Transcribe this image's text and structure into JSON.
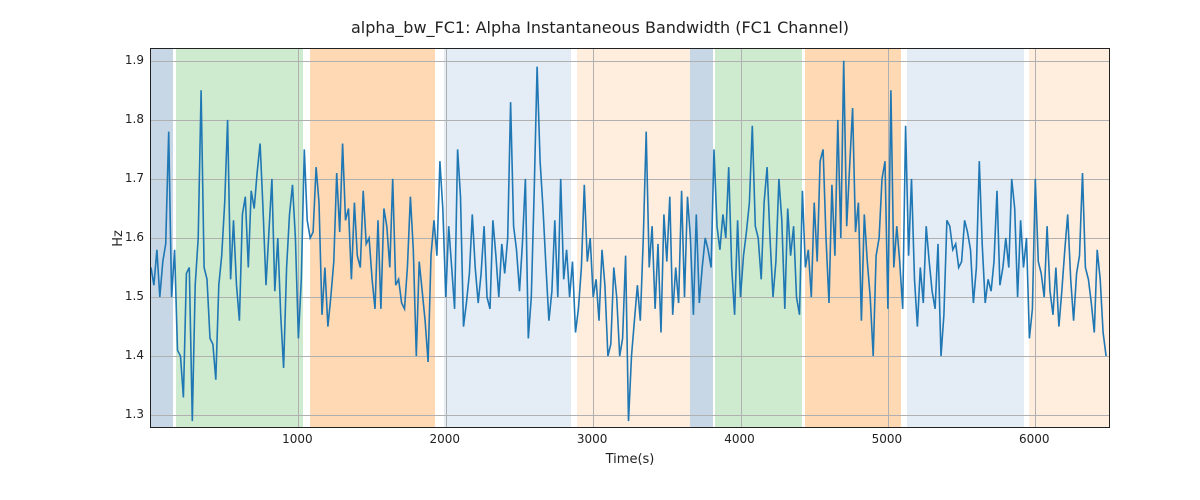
{
  "chart_data": {
    "type": "line",
    "title": "alpha_bw_FC1: Alpha Instantaneous Bandwidth (FC1 Channel)",
    "xlabel": "Time(s)",
    "ylabel": "Hz",
    "xlim": [
      0,
      6500
    ],
    "ylim": [
      1.28,
      1.92
    ],
    "xticks": [
      1000,
      2000,
      3000,
      4000,
      5000,
      6000
    ],
    "yticks": [
      1.3,
      1.4,
      1.5,
      1.6,
      1.7,
      1.8,
      1.9
    ],
    "grid": true,
    "shaded_regions": [
      {
        "start": 0,
        "end": 150,
        "color": "#b5c9dd",
        "alpha": 0.75
      },
      {
        "start": 170,
        "end": 1030,
        "color": "#b6e0b6",
        "alpha": 0.65
      },
      {
        "start": 1080,
        "end": 1930,
        "color": "#ffcc99",
        "alpha": 0.75
      },
      {
        "start": 1990,
        "end": 2850,
        "color": "#d6e2ef",
        "alpha": 0.65
      },
      {
        "start": 2890,
        "end": 3660,
        "color": "#ffe5cc",
        "alpha": 0.65
      },
      {
        "start": 3660,
        "end": 3810,
        "color": "#b5c9dd",
        "alpha": 0.75
      },
      {
        "start": 3830,
        "end": 4420,
        "color": "#b6e0b6",
        "alpha": 0.65
      },
      {
        "start": 4440,
        "end": 5090,
        "color": "#ffcc99",
        "alpha": 0.75
      },
      {
        "start": 5130,
        "end": 5920,
        "color": "#d6e2ef",
        "alpha": 0.65
      },
      {
        "start": 5960,
        "end": 6500,
        "color": "#ffe5cc",
        "alpha": 0.65
      }
    ],
    "series": [
      {
        "name": "alpha_bw_FC1",
        "color": "#1f77b4",
        "x_step": 20,
        "x_start": 0,
        "values": [
          1.55,
          1.52,
          1.58,
          1.5,
          1.56,
          1.59,
          1.78,
          1.5,
          1.58,
          1.41,
          1.4,
          1.33,
          1.54,
          1.55,
          1.29,
          1.52,
          1.6,
          1.85,
          1.55,
          1.53,
          1.43,
          1.42,
          1.36,
          1.52,
          1.57,
          1.66,
          1.8,
          1.53,
          1.63,
          1.52,
          1.46,
          1.64,
          1.67,
          1.55,
          1.68,
          1.65,
          1.71,
          1.76,
          1.65,
          1.52,
          1.61,
          1.7,
          1.51,
          1.6,
          1.47,
          1.38,
          1.55,
          1.64,
          1.69,
          1.6,
          1.43,
          1.53,
          1.75,
          1.63,
          1.6,
          1.61,
          1.72,
          1.66,
          1.47,
          1.55,
          1.45,
          1.5,
          1.56,
          1.71,
          1.61,
          1.76,
          1.63,
          1.65,
          1.53,
          1.66,
          1.57,
          1.55,
          1.68,
          1.59,
          1.6,
          1.53,
          1.48,
          1.63,
          1.48,
          1.65,
          1.62,
          1.55,
          1.7,
          1.52,
          1.53,
          1.49,
          1.48,
          1.55,
          1.67,
          1.58,
          1.4,
          1.56,
          1.51,
          1.46,
          1.39,
          1.57,
          1.63,
          1.57,
          1.73,
          1.65,
          1.5,
          1.62,
          1.55,
          1.48,
          1.75,
          1.67,
          1.45,
          1.49,
          1.54,
          1.64,
          1.55,
          1.49,
          1.54,
          1.62,
          1.5,
          1.48,
          1.63,
          1.57,
          1.5,
          1.59,
          1.54,
          1.6,
          1.83,
          1.62,
          1.58,
          1.51,
          1.59,
          1.7,
          1.43,
          1.5,
          1.68,
          1.89,
          1.73,
          1.65,
          1.55,
          1.46,
          1.51,
          1.63,
          1.5,
          1.7,
          1.53,
          1.58,
          1.5,
          1.56,
          1.44,
          1.48,
          1.55,
          1.69,
          1.56,
          1.6,
          1.5,
          1.53,
          1.46,
          1.58,
          1.52,
          1.4,
          1.42,
          1.55,
          1.5,
          1.4,
          1.43,
          1.57,
          1.29,
          1.4,
          1.46,
          1.52,
          1.46,
          1.6,
          1.78,
          1.55,
          1.62,
          1.48,
          1.59,
          1.44,
          1.64,
          1.56,
          1.67,
          1.47,
          1.55,
          1.49,
          1.68,
          1.5,
          1.67,
          1.6,
          1.47,
          1.64,
          1.49,
          1.55,
          1.6,
          1.58,
          1.55,
          1.75,
          1.62,
          1.58,
          1.64,
          1.6,
          1.72,
          1.55,
          1.47,
          1.63,
          1.5,
          1.57,
          1.61,
          1.66,
          1.79,
          1.62,
          1.6,
          1.53,
          1.66,
          1.72,
          1.6,
          1.5,
          1.56,
          1.7,
          1.63,
          1.48,
          1.65,
          1.57,
          1.62,
          1.5,
          1.47,
          1.68,
          1.55,
          1.58,
          1.5,
          1.66,
          1.56,
          1.73,
          1.75,
          1.6,
          1.49,
          1.69,
          1.57,
          1.8,
          1.6,
          1.9,
          1.62,
          1.72,
          1.82,
          1.61,
          1.66,
          1.46,
          1.64,
          1.56,
          1.5,
          1.4,
          1.57,
          1.6,
          1.7,
          1.73,
          1.48,
          1.85,
          1.55,
          1.62,
          1.56,
          1.48,
          1.79,
          1.57,
          1.7,
          1.53,
          1.45,
          1.55,
          1.49,
          1.62,
          1.56,
          1.51,
          1.48,
          1.59,
          1.4,
          1.47,
          1.63,
          1.62,
          1.58,
          1.59,
          1.55,
          1.56,
          1.63,
          1.61,
          1.58,
          1.49,
          1.55,
          1.73,
          1.59,
          1.49,
          1.53,
          1.51,
          1.56,
          1.68,
          1.52,
          1.55,
          1.6,
          1.55,
          1.7,
          1.65,
          1.5,
          1.63,
          1.55,
          1.6,
          1.43,
          1.48,
          1.7,
          1.56,
          1.54,
          1.5,
          1.62,
          1.51,
          1.47,
          1.55,
          1.45,
          1.51,
          1.58,
          1.64,
          1.53,
          1.46,
          1.54,
          1.57,
          1.71,
          1.55,
          1.53,
          1.49,
          1.44,
          1.58,
          1.53,
          1.44,
          1.4
        ]
      }
    ]
  }
}
